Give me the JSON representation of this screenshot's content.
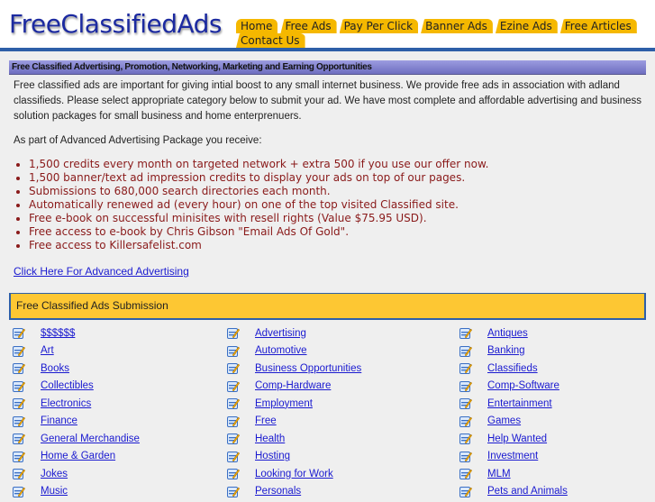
{
  "header": {
    "logo": "FreeClassifiedAds",
    "tabs": [
      {
        "label": "Home"
      },
      {
        "label": "Free Ads"
      },
      {
        "label": "Pay Per Click"
      },
      {
        "label": "Banner Ads"
      },
      {
        "label": "Ezine Ads"
      },
      {
        "label": "Free Articles"
      },
      {
        "label": "Contact Us"
      }
    ]
  },
  "banner": {
    "title": "Free Classified Advertising, Promotion, Networking, Marketing and Earning Opportunities"
  },
  "intro": {
    "text": "Free classified ads are important for giving intial boost to any small internet business. We provide free ads in association with adland classifieds. Please select appropriate category below to submit your ad. We have most complete and affordable advertising and business solution packages for small business and home enterprenuers."
  },
  "package": {
    "heading": "As part of Advanced Advertising Package you receive:",
    "benefits": [
      "1,500 credits every month on targeted network + extra 500 if you use our offer now.",
      "1,500 banner/text ad impression credits to display your ads on top of our pages.",
      "Submissions to 680,000 search directories each month.",
      "Automatically renewed ad (every hour) on one of the top visited Classified site.",
      "Free e-book on successful minisites with resell rights (Value $75.95 USD).",
      "Free access to e-book by Chris Gibson \"Email Ads Of Gold\".",
      "Free access to Killersafelist.com"
    ],
    "link": "Click Here For Advanced Advertising"
  },
  "submission": {
    "title": "Free Classified Ads Submission",
    "icon": "edit-document-icon",
    "rows": [
      [
        "$$$$$$",
        "Advertising",
        "Antiques"
      ],
      [
        "Art",
        "Automotive",
        "Banking"
      ],
      [
        "Books",
        "Business Opportunities",
        "Classifieds"
      ],
      [
        "Collectibles",
        "Comp-Hardware",
        "Comp-Software"
      ],
      [
        "Electronics",
        "Employment",
        "Entertainment"
      ],
      [
        "Finance",
        "Free",
        "Games"
      ],
      [
        "General Merchandise",
        "Health",
        "Help Wanted"
      ],
      [
        "Home & Garden",
        "Hosting",
        "Investment"
      ],
      [
        "Jokes",
        "Looking for Work",
        "MLM"
      ],
      [
        "Music",
        "Personals",
        "Pets and Animals"
      ]
    ]
  },
  "colors": {
    "tab": "#f5b800",
    "accent_blue": "#2e5fa8",
    "link": "#1a1ad0",
    "benefit_text": "#8a1a1a",
    "section_yellow": "#fdc733"
  }
}
